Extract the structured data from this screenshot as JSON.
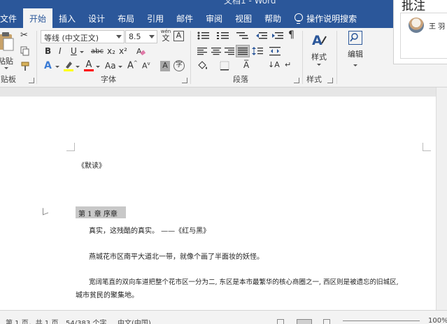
{
  "window": {
    "title_partial": "文档1 - Word"
  },
  "tabs": [
    {
      "label": "文件",
      "active": false
    },
    {
      "label": "开始",
      "active": true
    },
    {
      "label": "插入",
      "active": false
    },
    {
      "label": "设计",
      "active": false
    },
    {
      "label": "布局",
      "active": false
    },
    {
      "label": "引用",
      "active": false
    },
    {
      "label": "邮件",
      "active": false
    },
    {
      "label": "审阅",
      "active": false
    },
    {
      "label": "视图",
      "active": false
    },
    {
      "label": "帮助",
      "active": false
    }
  ],
  "tell_me": {
    "label": "操作说明搜索"
  },
  "ribbon": {
    "clipboard": {
      "paste_label": "粘贴",
      "group_label": "剪贴板"
    },
    "font": {
      "font_name": "等线 (中文正文)",
      "font_size": "8.5",
      "wen_label": "wén",
      "wen_char": "文",
      "bold": "B",
      "italic": "I",
      "underline": "U",
      "strike": "abc",
      "subscript": "x₂",
      "superscript": "x²",
      "font_color_letter": "A",
      "char_style": "Aa",
      "grow": "A",
      "shrink": "A",
      "char_shade": "A",
      "enclosed": "字",
      "group_label": "字体"
    },
    "paragraph": {
      "group_label": "段落"
    },
    "styles": {
      "button_label": "样式",
      "group_label": "样式"
    },
    "editing": {
      "button_label": "编辑"
    }
  },
  "comments_pane": {
    "title": "批注",
    "author": "王 羽"
  },
  "document": {
    "book_title": "《默读》",
    "chapter_heading": "第 1 章  序章",
    "paragraphs": [
      "真实，这残酷的真实。    ——《红与黑》",
      "燕城花市区南平大道北一带，就像个画了半面妆的妖怪。",
      "宽阔笔直的双向车道把整个花市区一分为二, 东区是本市最繁华的核心商圈之一, 西区则是被遗忘的旧城区,",
      "城市贫民的聚集地。"
    ]
  },
  "status_bar": {
    "page_info": "第 1 页，共 1 页",
    "word_count": "54/383 个字",
    "language": "中文(中国)",
    "zoom": "100%"
  },
  "colors": {
    "accent": "#2b579a",
    "ribbon_bg": "#f3f3f3",
    "highlight": "#ffff00",
    "font_color": "#ff0000"
  }
}
